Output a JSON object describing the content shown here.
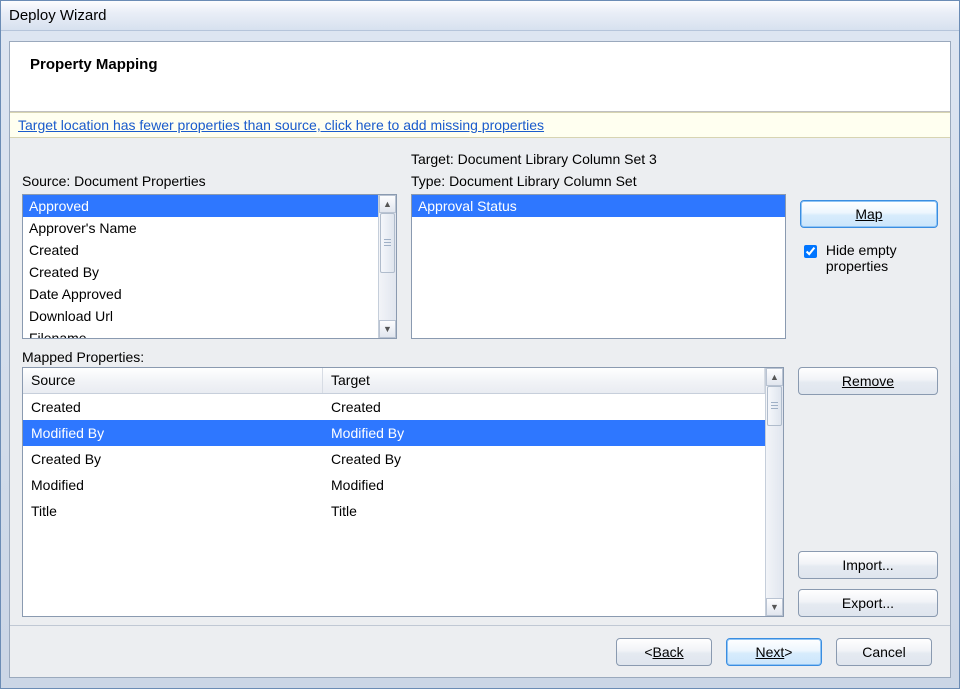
{
  "window": {
    "title": "Deploy Wizard"
  },
  "header": {
    "title": "Property Mapping"
  },
  "warning": {
    "link_text": "Target location has fewer properties than source, click here to add missing properties"
  },
  "source": {
    "label": "Source: Document Properties",
    "items": [
      "Approved",
      "Approver's Name",
      "Created",
      "Created By",
      "Date Approved",
      "Download Url",
      "Filename"
    ],
    "selected_index": 0
  },
  "target": {
    "label": "Target: Document Library Column Set 3",
    "type_label": "Type: Document Library Column Set",
    "items": [
      "Approval Status"
    ],
    "selected_index": 0
  },
  "side": {
    "map_label": "Map",
    "hide_empty_checked": true,
    "hide_empty_label": "Hide empty properties",
    "remove_label": "Remove",
    "import_label": "Import...",
    "export_label": "Export..."
  },
  "mapped": {
    "label": "Mapped Properties:",
    "columns": {
      "source": "Source",
      "target": "Target"
    },
    "rows": [
      {
        "source": "Created",
        "target": "Created"
      },
      {
        "source": "Modified By",
        "target": "Modified By"
      },
      {
        "source": "Created By",
        "target": "Created By"
      },
      {
        "source": "Modified",
        "target": "Modified"
      },
      {
        "source": "Title",
        "target": "Title"
      }
    ],
    "selected_index": 1
  },
  "footer": {
    "back": "Back",
    "next": "Next",
    "cancel": "Cancel"
  }
}
